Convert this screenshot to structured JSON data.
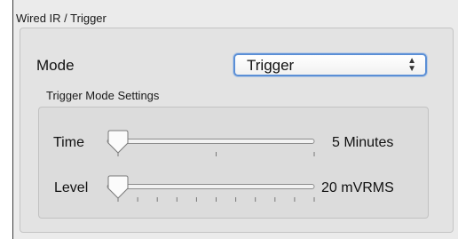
{
  "group": {
    "title": "Wired IR / Trigger"
  },
  "mode": {
    "label": "Mode",
    "selected": "Trigger"
  },
  "trigger_settings": {
    "title": "Trigger Mode Settings",
    "time": {
      "label": "Time",
      "value_text": "5 Minutes",
      "level": 0.0,
      "tick_count": 3
    },
    "level": {
      "label": "Level",
      "value_text": "20 mVRMS",
      "level": 0.0,
      "tick_count": 11
    }
  },
  "colors": {
    "focus_ring": "#5b8fd6",
    "panel": "#ebebeb",
    "group_box": "#dcdcdc"
  }
}
